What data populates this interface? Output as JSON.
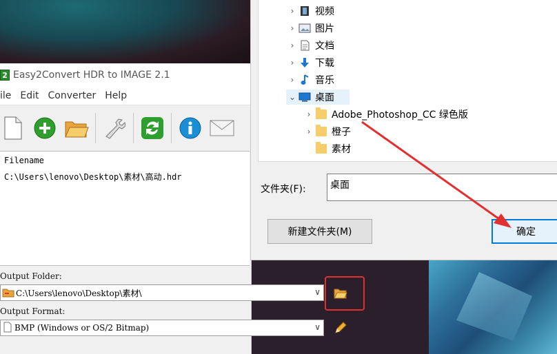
{
  "app": {
    "title": "Easy2Convert HDR to IMAGE 2.1",
    "icon_text": "2",
    "menu": [
      "ile",
      "Edit",
      "Converter",
      "Help"
    ],
    "toolbar_icons": [
      "new-file-icon",
      "add-icon",
      "open-folder-icon",
      "settings-wrench-icon",
      "refresh-convert-icon",
      "info-icon",
      "email-icon"
    ],
    "file_list": {
      "header": "Filename",
      "rows": [
        "C:\\Users\\lenovo\\Desktop\\素材\\高动.hdr"
      ]
    },
    "output_folder": {
      "label": "Output Folder:",
      "value": "C:\\Users\\lenovo\\Desktop\\素材\\"
    },
    "output_format": {
      "label": "Output Format:",
      "value": "BMP (Windows or OS/2 Bitmap)"
    }
  },
  "dialog": {
    "tree": [
      {
        "label": "视频",
        "icon": "video-icon"
      },
      {
        "label": "图片",
        "icon": "pictures-icon"
      },
      {
        "label": "文档",
        "icon": "documents-icon"
      },
      {
        "label": "下载",
        "icon": "download-icon"
      },
      {
        "label": "音乐",
        "icon": "music-icon"
      },
      {
        "label": "桌面",
        "icon": "desktop-icon"
      },
      {
        "label": "Adobe_Photoshop_CC  绿色版",
        "icon": "folder-icon"
      },
      {
        "label": "橙子",
        "icon": "folder-icon"
      },
      {
        "label": "素材",
        "icon": "folder-icon"
      }
    ],
    "folder_label": "文件夹(F):",
    "folder_value": "桌面",
    "new_folder_button": "新建文件夹(M)",
    "ok_button": "确定"
  },
  "colors": {
    "annotation_red": "#e03030",
    "selection_blue": "#0078d7"
  }
}
